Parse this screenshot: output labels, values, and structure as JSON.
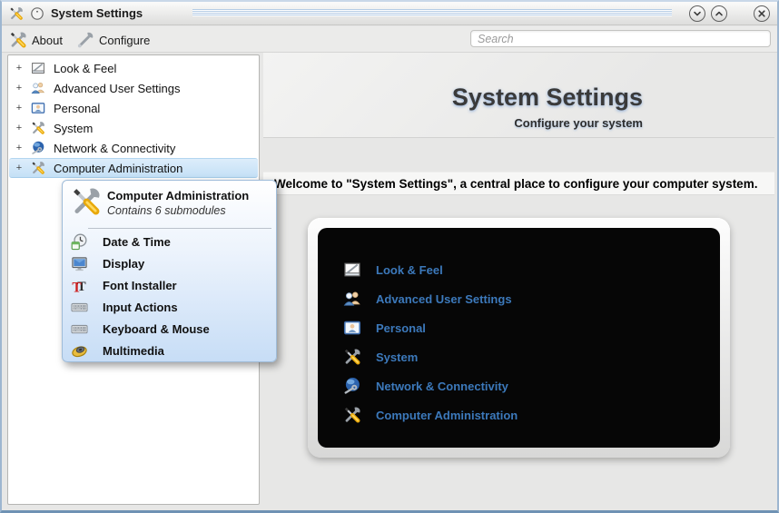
{
  "window": {
    "title": "System Settings",
    "controls": [
      {
        "name": "minimize",
        "icon": "chevron-down-icon"
      },
      {
        "name": "maximize",
        "icon": "chevron-up-icon"
      },
      {
        "name": "close",
        "icon": "close-icon"
      }
    ],
    "app_icon": "crossed-tools-icon",
    "menu_button_icon": "circle-dot-icon"
  },
  "toolbar": {
    "about_label": "About",
    "about_icon": "crossed-tools-icon",
    "configure_label": "Configure",
    "configure_icon": "wrench-icon",
    "search_placeholder": "Search"
  },
  "sidebar": {
    "expander_glyph": "+",
    "items": [
      {
        "label": "Look & Feel",
        "icon": "look-feel-icon",
        "selected": false
      },
      {
        "label": "Advanced User Settings",
        "icon": "users-icon",
        "selected": false
      },
      {
        "label": "Personal",
        "icon": "personal-card-icon",
        "selected": false
      },
      {
        "label": "System",
        "icon": "crossed-tools-icon",
        "selected": false
      },
      {
        "label": "Network & Connectivity",
        "icon": "globe-wrench-icon",
        "selected": false
      },
      {
        "label": "Computer Administration",
        "icon": "crossed-tools-icon",
        "selected": true
      }
    ]
  },
  "popup": {
    "title": "Computer Administration",
    "subtitle": "Contains 6 submodules",
    "icon": "crossed-tools-icon",
    "items": [
      {
        "label": "Date & Time",
        "icon": "clock-calendar-icon"
      },
      {
        "label": "Display",
        "icon": "monitor-icon"
      },
      {
        "label": "Font Installer",
        "icon": "font-letters-icon"
      },
      {
        "label": "Input Actions",
        "icon": "keyboard-icon"
      },
      {
        "label": "Keyboard & Mouse",
        "icon": "keyboard-icon"
      },
      {
        "label": "Multimedia",
        "icon": "speaker-icon"
      }
    ]
  },
  "content": {
    "title": "System Settings",
    "subtitle": "Configure your system",
    "welcome": "Welcome to \"System Settings\", a central place to configure your computer system.",
    "accent_color": "#3c79bb",
    "overview_items": [
      {
        "label": "Look & Feel",
        "icon": "look-feel-icon"
      },
      {
        "label": "Advanced User Settings",
        "icon": "users-icon"
      },
      {
        "label": "Personal",
        "icon": "personal-card-icon"
      },
      {
        "label": "System",
        "icon": "crossed-tools-icon"
      },
      {
        "label": "Network & Connectivity",
        "icon": "globe-wrench-icon"
      },
      {
        "label": "Computer Administration",
        "icon": "crossed-tools-icon"
      }
    ]
  }
}
